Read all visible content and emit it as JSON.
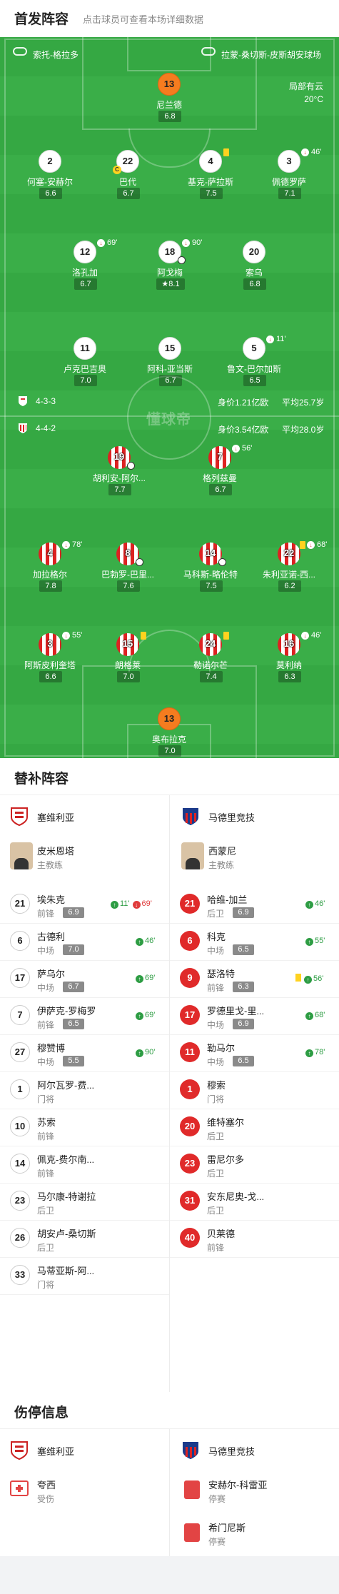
{
  "lineup": {
    "title": "首发阵容",
    "hint": "点击球员可查看本场详细数据",
    "home_team": "索托-格拉多",
    "away_team": "拉蒙-桑切斯-皮斯胡安球场",
    "weather": "局部有云",
    "temperature": "20°C",
    "watermark": "懂球帝",
    "home_formation": "4-3-3",
    "home_value": "身价1.21亿欧",
    "home_age": "平均25.7岁",
    "away_formation": "4-4-2",
    "away_value": "身价3.54亿欧",
    "away_age": "平均28.0岁"
  },
  "pitch_players": [
    {
      "num": "13",
      "name": "尼兰德",
      "rating": "6.8"
    },
    {
      "num": "2",
      "name": "何塞-安赫尔",
      "rating": "6.6"
    },
    {
      "num": "22",
      "name": "巴代",
      "rating": "6.7"
    },
    {
      "num": "4",
      "name": "基克-萨拉斯",
      "rating": "7.5"
    },
    {
      "num": "3",
      "name": "佩德罗萨",
      "rating": "7.1",
      "sub": "46'"
    },
    {
      "num": "12",
      "name": "洛孔加",
      "rating": "6.7",
      "sub": "69'"
    },
    {
      "num": "18",
      "name": "阿戈梅",
      "rating": "8.1",
      "sub": "90'"
    },
    {
      "num": "20",
      "name": "索乌",
      "rating": "6.8"
    },
    {
      "num": "11",
      "name": "卢克巴吉奥",
      "rating": "7.0"
    },
    {
      "num": "15",
      "name": "阿科-亚当斯",
      "rating": "6.7"
    },
    {
      "num": "5",
      "name": "鲁文-巴尔加斯",
      "rating": "6.5",
      "sub": "11'"
    },
    {
      "num": "19",
      "name": "胡利安-阿尔...",
      "rating": "7.7"
    },
    {
      "num": "7",
      "name": "格列兹曼",
      "rating": "6.7",
      "sub": "56'"
    },
    {
      "num": "4",
      "name": "加拉格尔",
      "rating": "7.8",
      "sub": "78'"
    },
    {
      "num": "8",
      "name": "巴勃罗-巴里...",
      "rating": "7.6"
    },
    {
      "num": "14",
      "name": "马科斯-略伦特",
      "rating": "7.5"
    },
    {
      "num": "22",
      "name": "朱利亚诺-西...",
      "rating": "6.2",
      "sub": "68'"
    },
    {
      "num": "3",
      "name": "阿斯皮利奎塔",
      "rating": "6.6",
      "sub": "55'"
    },
    {
      "num": "15",
      "name": "朗格莱",
      "rating": "7.0"
    },
    {
      "num": "24",
      "name": "勒诺尔芒",
      "rating": "7.4"
    },
    {
      "num": "16",
      "name": "莫利纳",
      "rating": "6.3",
      "sub": "46'"
    },
    {
      "num": "13",
      "name": "奥布拉克",
      "rating": "7.0"
    }
  ],
  "subs": {
    "title": "替补阵容",
    "home": {
      "team": "塞维利亚",
      "coach": "皮米恩塔",
      "coach_role": "主教练",
      "players": [
        {
          "num": "21",
          "name": "埃朱克",
          "pos": "前锋",
          "rating": "6.9",
          "in": "11'",
          "out": "69'"
        },
        {
          "num": "6",
          "name": "古德利",
          "pos": "中场",
          "rating": "7.0",
          "in": "46'"
        },
        {
          "num": "17",
          "name": "萨乌尔",
          "pos": "中场",
          "rating": "6.7",
          "in": "69'"
        },
        {
          "num": "7",
          "name": "伊萨克-罗梅罗",
          "pos": "前锋",
          "rating": "6.5",
          "in": "69'"
        },
        {
          "num": "27",
          "name": "穆赞博",
          "pos": "中场",
          "rating": "5.5",
          "in": "90'"
        },
        {
          "num": "1",
          "name": "阿尔瓦罗-费...",
          "pos": "门将"
        },
        {
          "num": "10",
          "name": "苏索",
          "pos": "前锋"
        },
        {
          "num": "14",
          "name": "佩克-费尔南...",
          "pos": "前锋"
        },
        {
          "num": "23",
          "name": "马尔康-特谢拉",
          "pos": "后卫"
        },
        {
          "num": "26",
          "name": "胡安卢-桑切斯",
          "pos": "后卫"
        },
        {
          "num": "33",
          "name": "马蒂亚斯-阿...",
          "pos": "门将"
        }
      ]
    },
    "away": {
      "team": "马德里竞技",
      "coach": "西蒙尼",
      "coach_role": "主教练",
      "players": [
        {
          "num": "21",
          "name": "哈维-加兰",
          "pos": "后卫",
          "rating": "6.9",
          "in": "46'"
        },
        {
          "num": "6",
          "name": "科克",
          "pos": "中场",
          "rating": "6.5",
          "in": "55'"
        },
        {
          "num": "9",
          "name": "瑟洛特",
          "pos": "前锋",
          "rating": "6.3",
          "in": "56'",
          "card": "yellow"
        },
        {
          "num": "17",
          "name": "罗德里戈-里...",
          "pos": "中场",
          "rating": "6.9",
          "in": "68'"
        },
        {
          "num": "11",
          "name": "勒马尔",
          "pos": "中场",
          "rating": "6.5",
          "in": "78'"
        },
        {
          "num": "1",
          "name": "穆索",
          "pos": "门将"
        },
        {
          "num": "20",
          "name": "维特塞尔",
          "pos": "后卫"
        },
        {
          "num": "23",
          "name": "雷尼尔多",
          "pos": "后卫"
        },
        {
          "num": "31",
          "name": "安东尼奥-戈...",
          "pos": "后卫"
        },
        {
          "num": "40",
          "name": "贝莱德",
          "pos": "前锋"
        }
      ]
    }
  },
  "injuries": {
    "title": "伤停信息",
    "home_team": "塞维利亚",
    "away_team": "马德里竞技",
    "home": [
      {
        "name": "夸西",
        "status": "受伤"
      }
    ],
    "away": [
      {
        "name": "安赫尔-科雷亚",
        "status": "停赛"
      },
      {
        "name": "希门尼斯",
        "status": "停赛"
      }
    ]
  },
  "colors": {
    "pitch": "#35a843",
    "goalkeeper": "#f57c1f",
    "atletico": "#e02a2a",
    "sub_in": "#2e9d44"
  }
}
